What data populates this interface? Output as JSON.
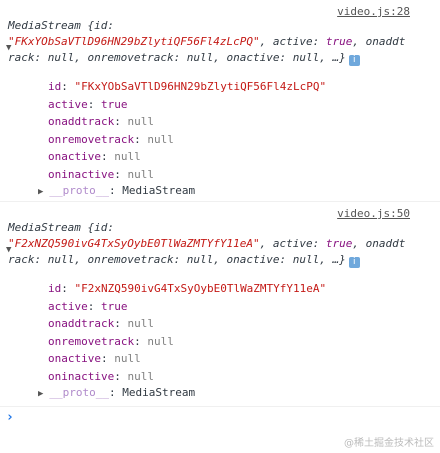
{
  "messages": [
    {
      "source": "video.js:28",
      "type_name": "MediaStream",
      "id": "FKxYObSaVTlD96HN29bZlytiQF56Fl4zLcPQ",
      "props": [
        {
          "key": "id",
          "value": "\"FKxYObSaVTlD96HN29bZlytiQF56Fl4zLcPQ\""
        },
        {
          "key": "active",
          "value": "true"
        },
        {
          "key": "onaddtrack",
          "value": "null"
        },
        {
          "key": "onremovetrack",
          "value": "null"
        },
        {
          "key": "onactive",
          "value": "null"
        },
        {
          "key": "oninactive",
          "value": "null"
        }
      ],
      "proto_key": "__proto__",
      "proto_value": "MediaStream"
    },
    {
      "source": "video.js:50",
      "type_name": "MediaStream",
      "id": "F2xNZQ590ivG4TxSyOybE0TlWaZMTYfY11eA",
      "props": [
        {
          "key": "id",
          "value": "\"F2xNZQ590ivG4TxSyOybE0TlWaZMTYfY11eA\""
        },
        {
          "key": "active",
          "value": "true"
        },
        {
          "key": "onaddtrack",
          "value": "null"
        },
        {
          "key": "onremovetrack",
          "value": "null"
        },
        {
          "key": "onactive",
          "value": "null"
        },
        {
          "key": "oninactive",
          "value": "null"
        }
      ],
      "proto_key": "__proto__",
      "proto_value": "MediaStream"
    }
  ],
  "prompt_symbol": "›",
  "watermark": "@稀土掘金技术社区",
  "colors": {
    "string": "#c41a16",
    "keyword": "#881280",
    "null": "#808080",
    "link": "#555555",
    "prompt": "#1a73e8"
  },
  "icons": {
    "expand": "triangle-expanded-icon",
    "collapsed": "triangle-collapsed-icon",
    "info": "info-icon"
  }
}
